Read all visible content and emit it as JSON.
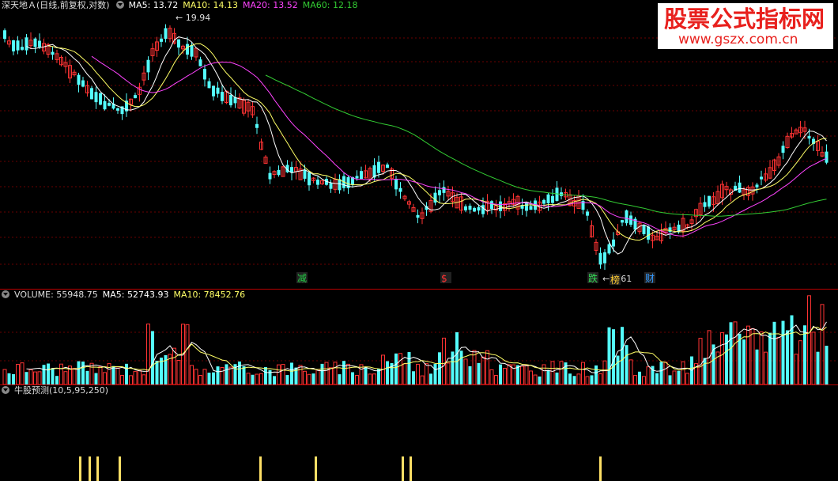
{
  "main": {
    "symbol": "深天地Ａ(日线,前复权,对数)",
    "ma5": "MA5: 13.72",
    "ma10": "MA10: 14.13",
    "ma20": "MA20: 13.52",
    "ma60": "MA60: 12.18",
    "high_label": "19.94",
    "low_label": "9.61",
    "markers": [
      {
        "text": "减",
        "color": "#22cc44"
      },
      {
        "text": "$",
        "color": "#ff3333"
      },
      {
        "text": "跌",
        "color": "#33dd55"
      },
      {
        "text": "榜",
        "color": "#ffcc33"
      },
      {
        "text": "财",
        "color": "#3399ff"
      }
    ]
  },
  "volume": {
    "title": "VOLUME: 55948.75",
    "ma5": "MA5: 52743.93",
    "ma10": "MA10: 78452.76"
  },
  "indicator": {
    "title": "牛股预测(10,5,95,250)"
  },
  "watermark": {
    "line1": "股票公式指标网",
    "line2": "www.gszx.com.cn"
  },
  "colors": {
    "up": "#ff3333",
    "down": "#54fcfc",
    "ma5": "#ffffff",
    "ma10": "#ffff66",
    "ma20": "#ff44ff",
    "ma60": "#33cc33",
    "signal": "#ffe066"
  }
}
